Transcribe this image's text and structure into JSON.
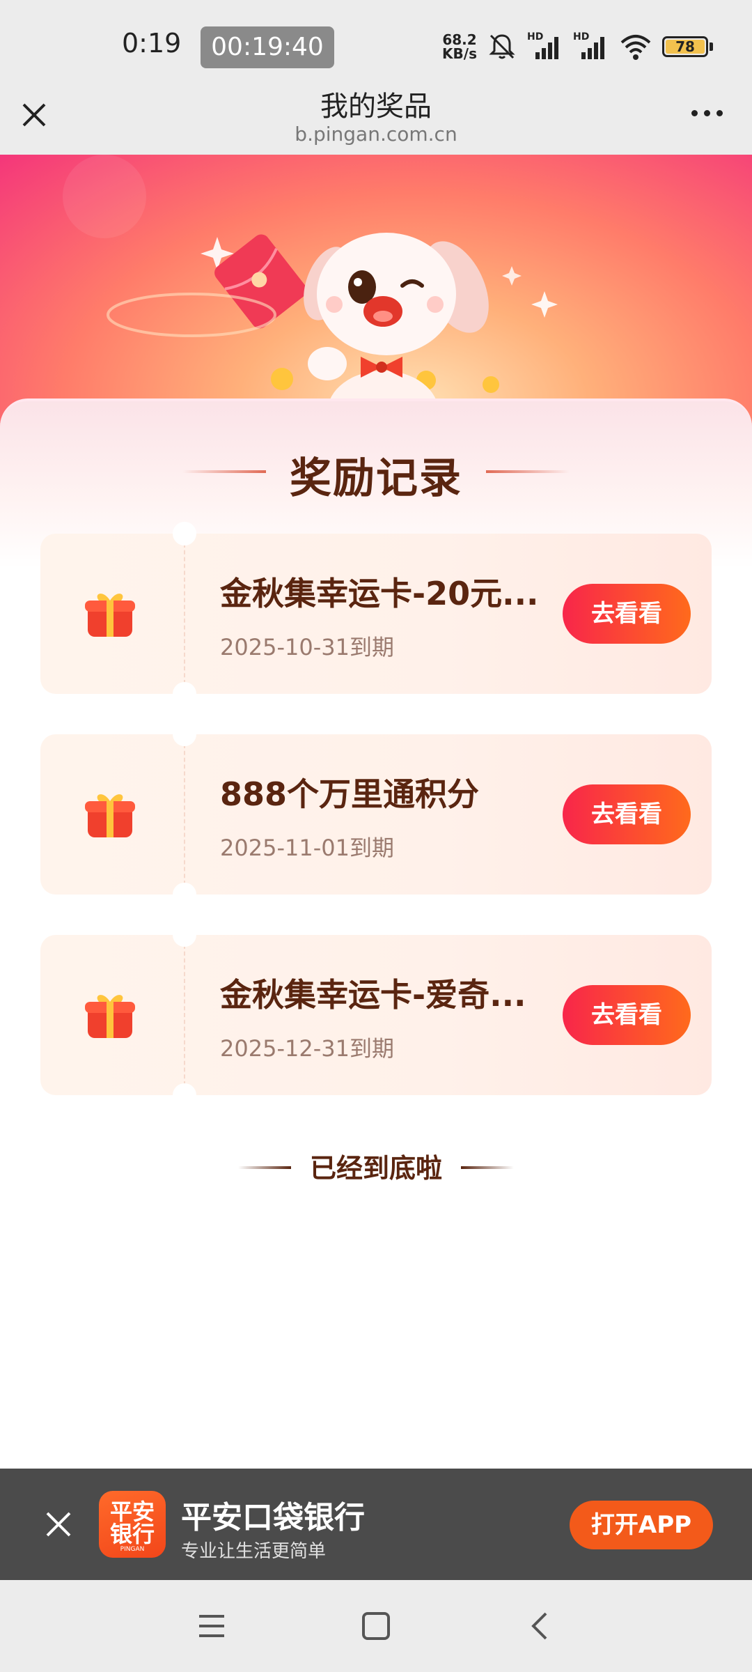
{
  "status_bar": {
    "time": "0:19",
    "timer": "00:19:40",
    "net_speed_value": "68.2",
    "net_speed_unit": "KB/s",
    "signal1_label": "HD",
    "signal2_label": "HD",
    "battery": "78"
  },
  "browser": {
    "title": "我的奖品",
    "url": "b.pingan.com.cn"
  },
  "section": {
    "title": "奖励记录"
  },
  "rewards": [
    {
      "name": "金秋集幸运卡-20元...",
      "expiry": "2025-10-31到期",
      "button": "去看看"
    },
    {
      "name": "888个万里通积分",
      "expiry": "2025-11-01到期",
      "button": "去看看"
    },
    {
      "name": "金秋集幸运卡-爱奇...",
      "expiry": "2025-12-31到期",
      "button": "去看看"
    }
  ],
  "end_text": "已经到底啦",
  "app_banner": {
    "logo_line1": "平安",
    "logo_line2": "银行",
    "logo_sub": "PINGAN",
    "name": "平安口袋银行",
    "slogan": "专业让生活更简单",
    "open_button": "打开APP"
  },
  "icons": {
    "close": "close-icon",
    "more": "more-icon",
    "gift": "gift-box-icon",
    "mute": "bell-mute-icon",
    "wifi": "wifi-icon",
    "menu": "menu-icon",
    "home": "home-icon",
    "back": "back-icon"
  }
}
